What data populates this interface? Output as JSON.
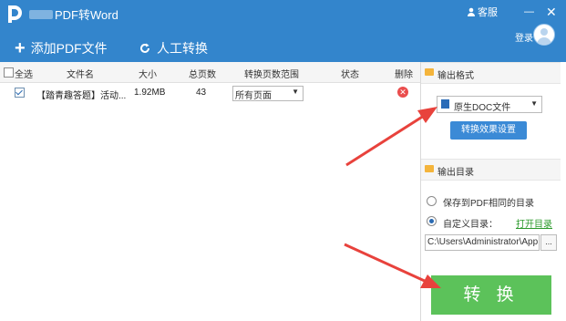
{
  "window": {
    "title": "PDF转Word",
    "service_label": "客服",
    "minimize_glyph": "—",
    "close_glyph": "✕"
  },
  "toolbar": {
    "add_pdf_label": "添加PDF文件",
    "manual_convert_label": "人工转换",
    "login_label": "登录"
  },
  "table": {
    "select_all_label": "全选",
    "columns": [
      "文件名",
      "大小",
      "总页数",
      "转换页数范围",
      "状态",
      "删除"
    ],
    "rows": [
      {
        "file_name": "【踏青趣答题】活动...",
        "size": "1.92MB",
        "pages": "43",
        "page_range": "所有页面",
        "status": "",
        "checked": true
      }
    ]
  },
  "panel": {
    "output_format_title": "输出格式",
    "format_selected": "原生DOC文件",
    "settings_button": "转换效果设置",
    "output_dir_title": "输出目录",
    "option_same_dir": "保存到PDF相同的目录",
    "option_custom_dir": "自定义目录：",
    "open_dir_link": "打开目录",
    "custom_path": "C:\\Users\\Administrator\\App",
    "browse_label": "...",
    "selected_option": "custom",
    "convert_button": "转 换"
  },
  "colors": {
    "header_bg": "#3385cc",
    "convert_button": "#5cc25a",
    "arrow": "#e8423c",
    "delete_icon": "#ea4d4d",
    "link_green": "#2c9a2c"
  }
}
